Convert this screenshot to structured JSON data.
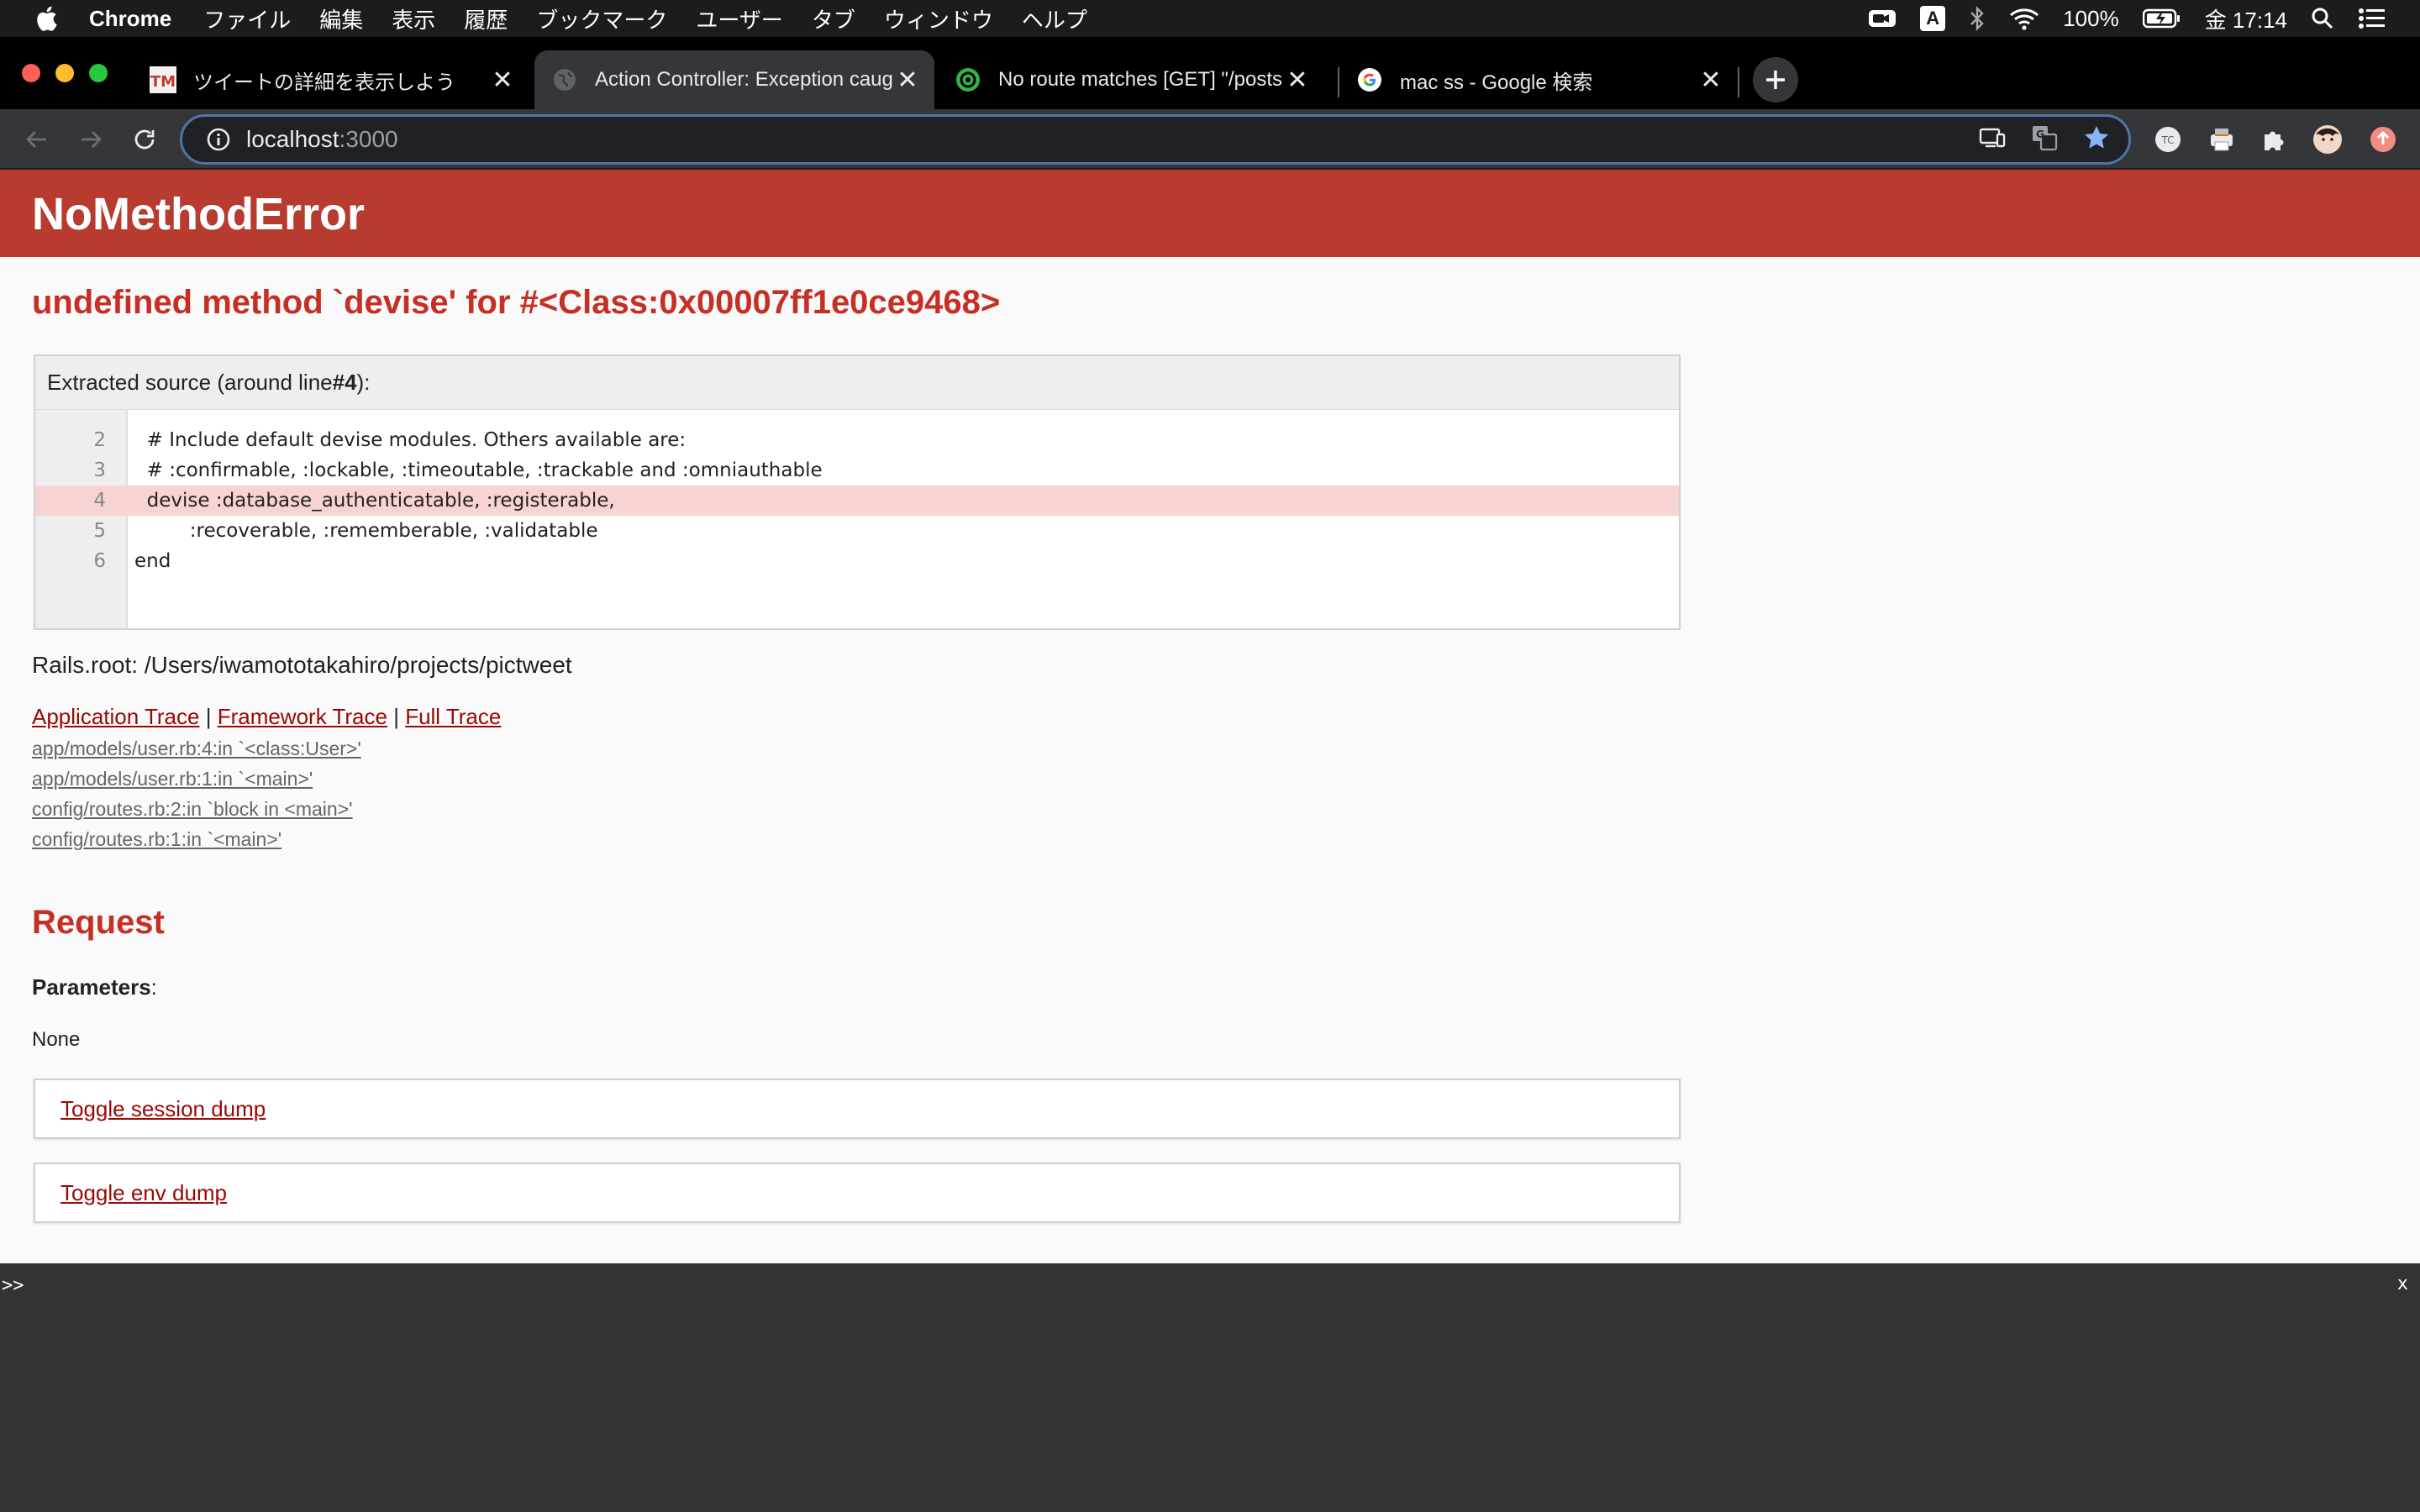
{
  "menubar": {
    "app_name": "Chrome",
    "items": [
      "ファイル",
      "編集",
      "表示",
      "履歴",
      "ブックマーク",
      "ユーザー",
      "タブ",
      "ウィンドウ",
      "ヘルプ"
    ],
    "input_source": "A",
    "battery": "100%",
    "clock": "金 17:14"
  },
  "tabs": [
    {
      "title": "ツイートの詳細を表示しよう",
      "favicon": "tm-icon"
    },
    {
      "title": "Action Controller: Exception caught",
      "favicon": "globe-icon"
    },
    {
      "title": "No route matches [GET] \"/posts\"",
      "favicon": "green-swirl-icon"
    },
    {
      "title": "mac ss - Google 検索",
      "favicon": "google-g-icon"
    }
  ],
  "omnibox": {
    "host": "localhost",
    "port": ":3000"
  },
  "error": {
    "title": "NoMethodError",
    "message": "undefined method `devise' for #<Class:0x00007ff1e0ce9468>"
  },
  "source": {
    "header_prefix": "Extracted source (around line ",
    "header_line": "#4",
    "header_suffix": "):",
    "lines": [
      {
        "num": "2",
        "code": "  # Include default devise modules. Others available are:"
      },
      {
        "num": "3",
        "code": "  # :confirmable, :lockable, :timeoutable, :trackable and :omniauthable"
      },
      {
        "num": "4",
        "code": "  devise :database_authenticatable, :registerable,"
      },
      {
        "num": "5",
        "code": "         :recoverable, :rememberable, :validatable"
      },
      {
        "num": "6",
        "code": "end"
      }
    ]
  },
  "rails_root": "Rails.root: /Users/iwamototakahiro/projects/pictweet",
  "trace": {
    "application": "Application Trace",
    "framework": "Framework Trace",
    "full": "Full Trace",
    "separator": "|",
    "lines": [
      "app/models/user.rb:4:in `<class:User>'",
      "app/models/user.rb:1:in `<main>'",
      "config/routes.rb:2:in `block in <main>'",
      "config/routes.rb:1:in `<main>'"
    ]
  },
  "request": {
    "title": "Request",
    "params_label": "Parameters",
    "params_colon": ":",
    "params_value": "None",
    "toggle_session": "Toggle session dump",
    "toggle_env": "Toggle env dump"
  },
  "console": {
    "prompt": ">>",
    "close": "x"
  },
  "colors": {
    "header_red": "#b73c2f",
    "error_text": "#c52f24",
    "link": "#980905",
    "highlight_line": "#f8d3d3",
    "console_bg": "#333333"
  }
}
